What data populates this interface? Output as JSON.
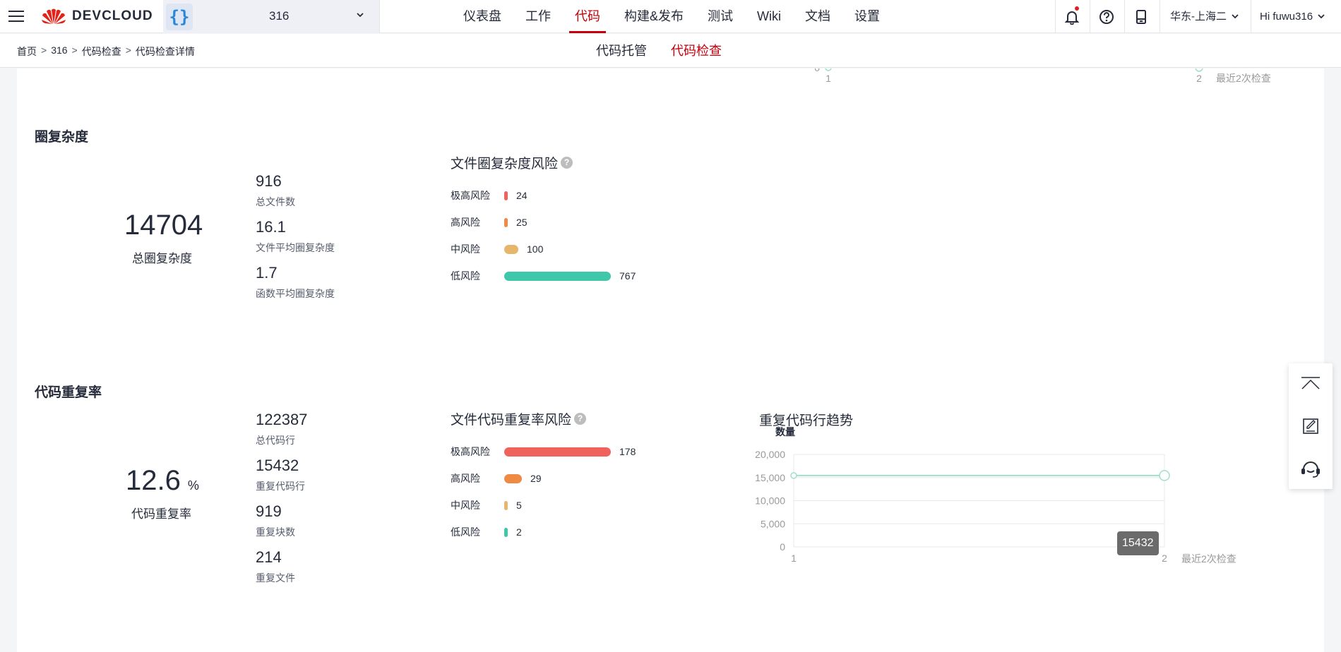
{
  "header": {
    "logo_text": "DEVCLOUD",
    "project_name": "316",
    "nav": [
      {
        "label": "仪表盘"
      },
      {
        "label": "工作"
      },
      {
        "label": "代码"
      },
      {
        "label": "构建&发布"
      },
      {
        "label": "测试"
      },
      {
        "label": "Wiki"
      },
      {
        "label": "文档"
      },
      {
        "label": "设置"
      }
    ],
    "active_nav": "代码",
    "region": "华东-上海二",
    "user": "Hi fuwu316"
  },
  "subheader": {
    "breadcrumb": [
      "首页",
      "316",
      "代码检查",
      "代码检查详情"
    ],
    "tabs": [
      {
        "label": "代码托管"
      },
      {
        "label": "代码检查"
      }
    ],
    "active_tab": "代码检查"
  },
  "top_chart_fragment": {
    "y_tick": "0",
    "x_ticks": [
      "1",
      "2"
    ],
    "x_label": "最近2次检查"
  },
  "complexity": {
    "title": "圈复杂度",
    "total": "14704",
    "total_label": "总圈复杂度",
    "stats": [
      {
        "value": "916",
        "label": "总文件数"
      },
      {
        "value": "16.1",
        "label": "文件平均圈复杂度"
      },
      {
        "value": "1.7",
        "label": "函数平均圈复杂度"
      }
    ],
    "risk_title": "文件圈复杂度风险",
    "risks": [
      {
        "label": "极高风险",
        "value": 24,
        "display": "24",
        "color": "#f0625c"
      },
      {
        "label": "高风险",
        "value": 25,
        "display": "25",
        "color": "#ef8a44"
      },
      {
        "label": "中风险",
        "value": 100,
        "display": "100",
        "color": "#e5b66c"
      },
      {
        "label": "低风险",
        "value": 767,
        "display": "767",
        "color": "#3ec7a8"
      }
    ]
  },
  "duplication": {
    "title": "代码重复率",
    "rate": "12.6",
    "rate_unit": "%",
    "rate_label": "代码重复率",
    "stats": [
      {
        "value": "122387",
        "label": "总代码行"
      },
      {
        "value": "15432",
        "label": "重复代码行"
      },
      {
        "value": "919",
        "label": "重复块数"
      },
      {
        "value": "214",
        "label": "重复文件"
      }
    ],
    "risk_title": "文件代码重复率风险",
    "risks": [
      {
        "label": "极高风险",
        "value": 178,
        "display": "178",
        "color": "#f0625c"
      },
      {
        "label": "高风险",
        "value": 29,
        "display": "29",
        "color": "#ef8a44"
      },
      {
        "label": "中风险",
        "value": 5,
        "display": "5",
        "color": "#e5b66c"
      },
      {
        "label": "低风险",
        "value": 2,
        "display": "2",
        "color": "#3ec7a8"
      }
    ]
  },
  "chart_data": {
    "type": "line",
    "title": "重复代码行趋势",
    "xlabel": "最近2次检查",
    "ylabel": "数量",
    "x": [
      "1",
      "2"
    ],
    "series": [
      {
        "values": [
          15432,
          15432
        ]
      }
    ],
    "ylim": [
      0,
      20000
    ],
    "y_ticks": [
      "0",
      "5,000",
      "10,000",
      "15,000",
      "20,000"
    ],
    "tooltip": "15432",
    "grid": true,
    "line_color": "#9fe0cd"
  }
}
